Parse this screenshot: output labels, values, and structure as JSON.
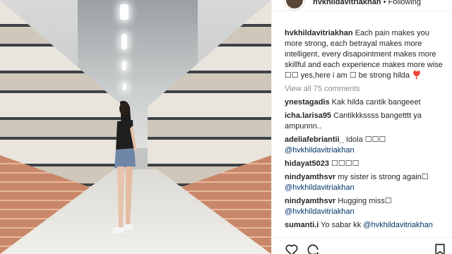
{
  "header": {
    "username": "hvkhildavitriakhan",
    "separator": "•",
    "follow_status": "Following"
  },
  "caption": {
    "username": "hvkhildavitriakhan",
    "text": "Each pain makes you more strong, each betrayal makes more intelligent, every disapointment makes more skillful and each experience makes more wise ☐☐ yes,here i am ☐ be strong hilda ❣️"
  },
  "view_all_label": "View all 75 comments",
  "comments": [
    {
      "username": "ynestagadis",
      "text": "Kak hilda cantik bangeeet",
      "mention": ""
    },
    {
      "username": "icha.larisa95",
      "text": "Cantikkkssss bangetttt ya ampunnn..",
      "mention": ""
    },
    {
      "username": "adeliafebriantii_",
      "text": "Idola ☐☐☐",
      "mention": "@hvkhildavitriakhan"
    },
    {
      "username": "hidayat5023",
      "text": "☐☐☐☐",
      "mention": ""
    },
    {
      "username": "nindyamthsvr",
      "text": "my sister is strong again☐",
      "mention": "@hvkhildavitriakhan"
    },
    {
      "username": "nindyamthsvr",
      "text": "Hugging miss☐",
      "mention": "@hvkhildavitriakhan"
    },
    {
      "username": "sumanti.i",
      "text": "Yo sabar kk",
      "mention": "@hvkhildavitriakhan"
    }
  ],
  "icons": [
    "heart-icon",
    "comment-icon",
    "save-icon"
  ],
  "colors": {
    "mention": "#003569",
    "muted": "#8e8e8e",
    "text": "#262626"
  }
}
